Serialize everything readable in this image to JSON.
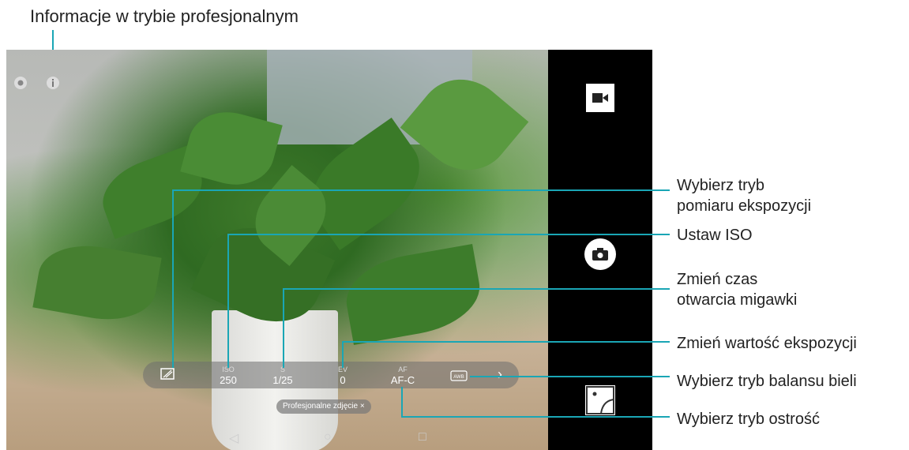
{
  "header": {
    "title": "Informacje w trybie profesjonalnym"
  },
  "controls": {
    "metering": {
      "value": ""
    },
    "iso": {
      "label": "ISO",
      "value": "250"
    },
    "shutter": {
      "label": "S",
      "value": "1/25"
    },
    "ev": {
      "label": "EV",
      "value": "0"
    },
    "af": {
      "label": "AF",
      "value": "AF-C"
    },
    "wb": {
      "label": "AWB"
    }
  },
  "mode_tag": "Profesjonalne zdjęcie ×",
  "callouts": {
    "metering": "Wybierz tryb\npomiaru ekspozycji",
    "metering_line1": "Wybierz tryb",
    "metering_line2": "pomiaru ekspozycji",
    "iso": "Ustaw ISO",
    "shutter_line1": "Zmień czas",
    "shutter_line2": "otwarcia migawki",
    "ev": "Zmień wartość ekspozycji",
    "wb": "Wybierz tryb balansu bieli",
    "af": "Wybierz tryb ostrość"
  },
  "colors": {
    "callout_line": "#1aa6b5",
    "sidebar": "#000000"
  }
}
